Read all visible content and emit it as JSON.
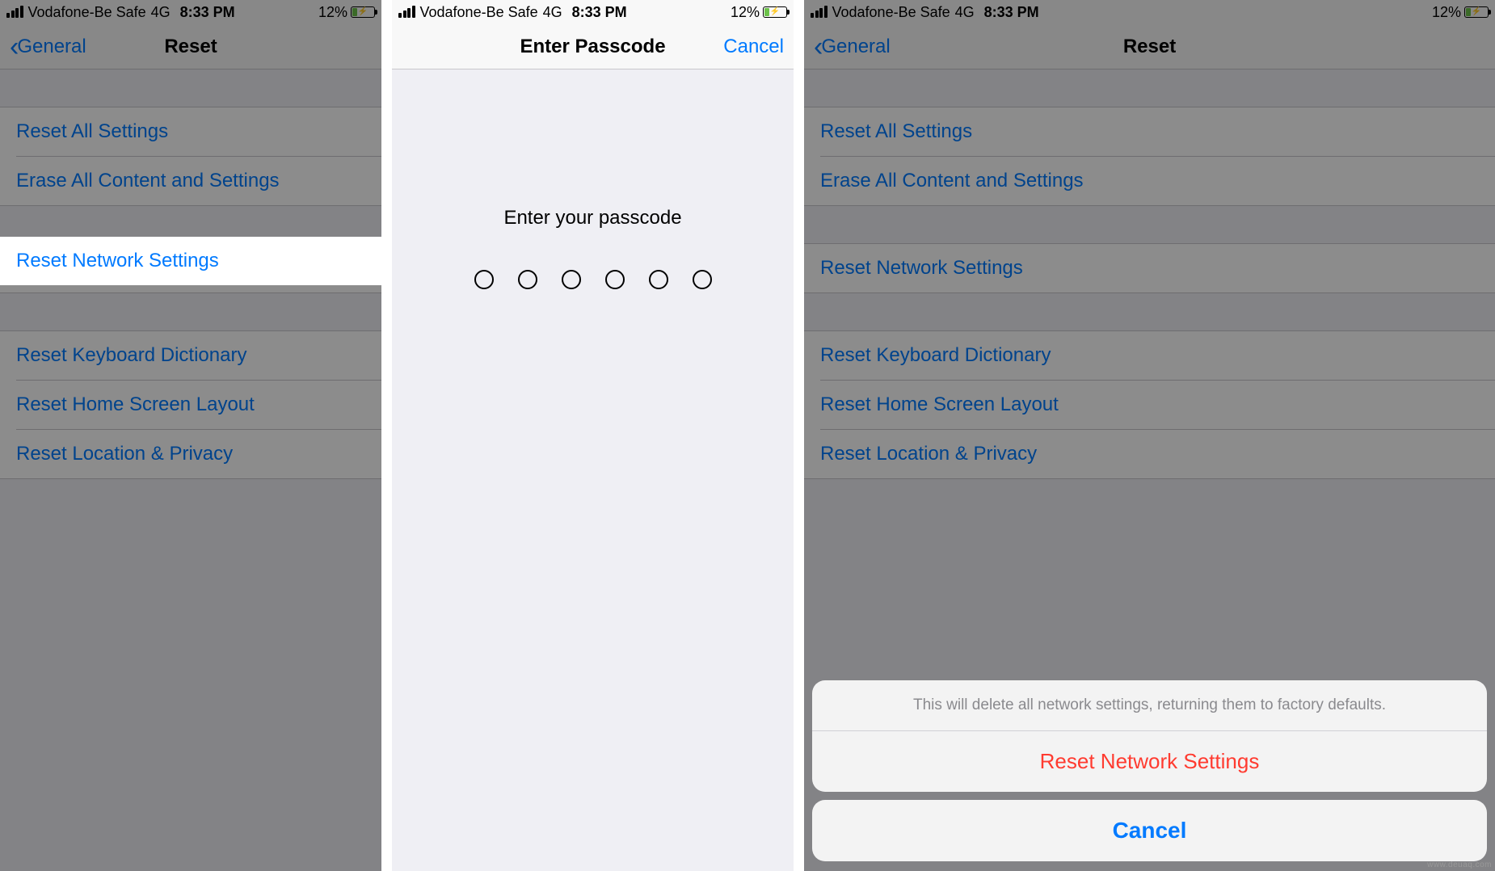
{
  "status": {
    "carrier": "Vodafone-Be Safe",
    "network": "4G",
    "time": "8:33 PM",
    "battery_pct": "12%"
  },
  "panel1": {
    "back_label": "General",
    "title": "Reset",
    "items_group1": [
      "Reset All Settings",
      "Erase All Content and Settings"
    ],
    "item_highlight": "Reset Network Settings",
    "items_group3": [
      "Reset Keyboard Dictionary",
      "Reset Home Screen Layout",
      "Reset Location & Privacy"
    ]
  },
  "panel2": {
    "title": "Enter Passcode",
    "cancel": "Cancel",
    "prompt": "Enter your passcode"
  },
  "panel3": {
    "back_label": "General",
    "title": "Reset",
    "items_group1": [
      "Reset All Settings",
      "Erase All Content and Settings"
    ],
    "items_group2": [
      "Reset Network Settings"
    ],
    "items_group3": [
      "Reset Keyboard Dictionary",
      "Reset Home Screen Layout",
      "Reset Location & Privacy"
    ],
    "sheet_msg": "This will delete all network settings, returning them to factory defaults.",
    "sheet_action": "Reset Network Settings",
    "sheet_cancel": "Cancel"
  },
  "watermark": "www.deuaq.com"
}
